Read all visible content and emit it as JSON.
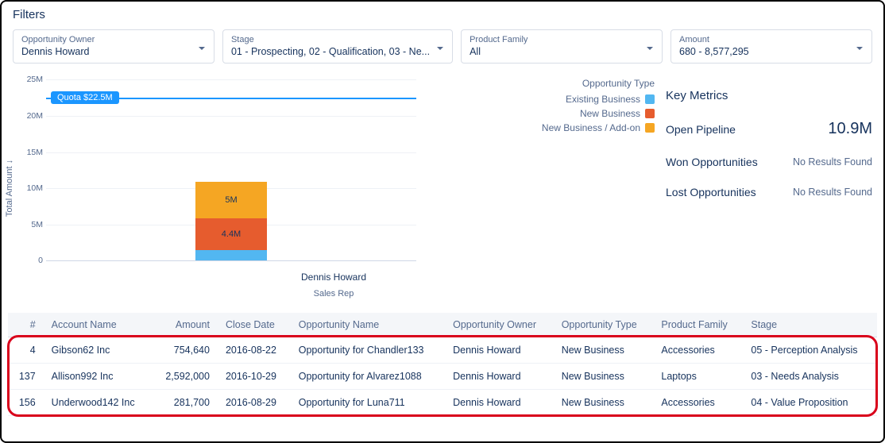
{
  "filters_title": "Filters",
  "filters": [
    {
      "label": "Opportunity Owner",
      "value": "Dennis Howard"
    },
    {
      "label": "Stage",
      "value": "01 - Prospecting, 02 - Qualification, 03 - Ne..."
    },
    {
      "label": "Product Family",
      "value": "All"
    },
    {
      "label": "Amount",
      "value": "680 - 8,577,295"
    }
  ],
  "legend": {
    "title": "Opportunity Type",
    "items": [
      {
        "label": "Existing Business",
        "color": "#52b7f1"
      },
      {
        "label": "New Business",
        "color": "#e65c2e"
      },
      {
        "label": "New Business / Add-on",
        "color": "#f5a623"
      }
    ]
  },
  "metrics": {
    "title": "Key Metrics",
    "rows": [
      {
        "label": "Open Pipeline",
        "value": "10.9M",
        "big": true
      },
      {
        "label": "Won Opportunities",
        "value": "No Results Found",
        "big": false
      },
      {
        "label": "Lost Opportunities",
        "value": "No Results Found",
        "big": false
      }
    ]
  },
  "chart_data": {
    "type": "bar",
    "title": "",
    "xlabel": "Sales Rep",
    "ylabel": "Total Amount ↓",
    "ylim": [
      0,
      25
    ],
    "yticks": [
      0,
      "5M",
      "10M",
      "15M",
      "20M",
      "25M"
    ],
    "quota": {
      "label": "Quota $22.5M",
      "value": 22.5
    },
    "categories": [
      "Dennis Howard"
    ],
    "series": [
      {
        "name": "Existing Business",
        "color": "#52b7f1",
        "values": [
          1.5
        ],
        "labels": [
          ""
        ]
      },
      {
        "name": "New Business",
        "color": "#e65c2e",
        "values": [
          4.4
        ],
        "labels": [
          "4.4M"
        ]
      },
      {
        "name": "New Business / Add-on",
        "color": "#f5a623",
        "values": [
          5.0
        ],
        "labels": [
          "5M"
        ]
      }
    ]
  },
  "table": {
    "columns": [
      "#",
      "Account Name",
      "Amount",
      "Close Date",
      "Opportunity Name",
      "Opportunity Owner",
      "Opportunity Type",
      "Product Family",
      "Stage"
    ],
    "rows": [
      {
        "num": "4",
        "account": "Gibson62 Inc",
        "amount": "754,640",
        "close": "2016-08-22",
        "opp": "Opportunity for Chandler133",
        "owner": "Dennis Howard",
        "type": "New Business",
        "family": "Accessories",
        "stage": "05 - Perception Analysis"
      },
      {
        "num": "137",
        "account": "Allison992 Inc",
        "amount": "2,592,000",
        "close": "2016-10-29",
        "opp": "Opportunity for Alvarez1088",
        "owner": "Dennis Howard",
        "type": "New Business",
        "family": "Laptops",
        "stage": "03 - Needs Analysis"
      },
      {
        "num": "156",
        "account": "Underwood142 Inc",
        "amount": "281,700",
        "close": "2016-08-29",
        "opp": "Opportunity for Luna711",
        "owner": "Dennis Howard",
        "type": "New Business",
        "family": "Accessories",
        "stage": "04 - Value Proposition"
      }
    ]
  }
}
